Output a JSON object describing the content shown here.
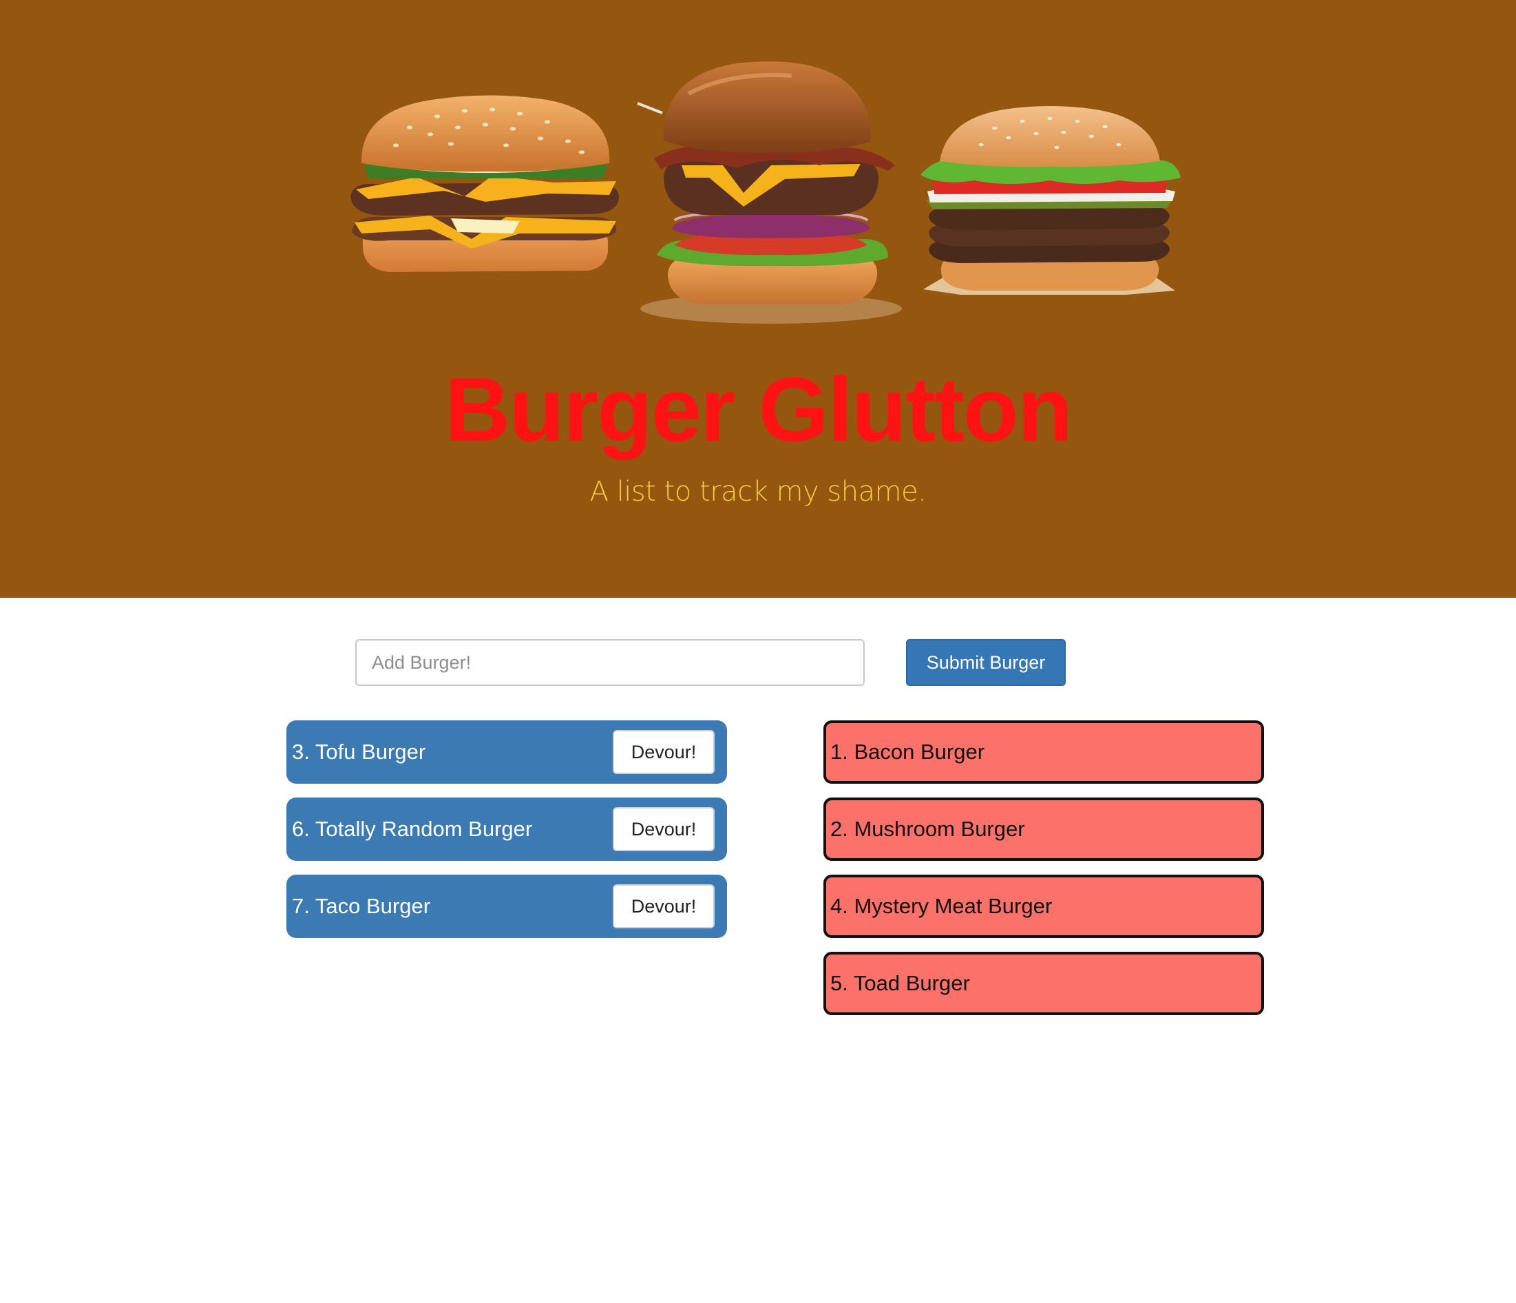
{
  "header": {
    "title": "Burger Glutton",
    "subtitle": "A list to track my shame."
  },
  "colors": {
    "hero_background": "#955610",
    "title": "#ff1212",
    "subtitle": "#f5cf3f",
    "primary": "#3577b5",
    "devoured_item": "#fc7169"
  },
  "form": {
    "input_placeholder": "Add Burger!",
    "input_value": "",
    "submit_label": "Submit Burger"
  },
  "not_devoured": [
    {
      "label": "3. Tofu Burger",
      "button": "Devour!"
    },
    {
      "label": "6. Totally Random Burger",
      "button": "Devour!"
    },
    {
      "label": "7. Taco Burger",
      "button": "Devour!"
    }
  ],
  "devoured": [
    {
      "label": "1. Bacon Burger"
    },
    {
      "label": "2. Mushroom Burger"
    },
    {
      "label": "4. Mystery Meat Burger"
    },
    {
      "label": "5. Toad Burger"
    }
  ]
}
